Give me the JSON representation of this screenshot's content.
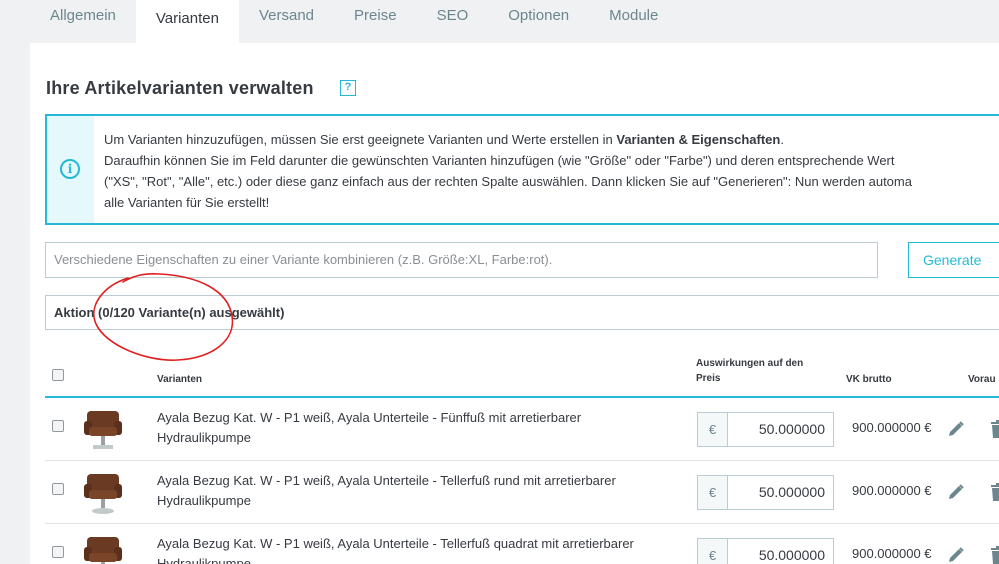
{
  "tabs": [
    {
      "label": "Allgemein",
      "active": false
    },
    {
      "label": "Varianten",
      "active": true
    },
    {
      "label": "Versand",
      "active": false
    },
    {
      "label": "Preise",
      "active": false
    },
    {
      "label": "SEO",
      "active": false
    },
    {
      "label": "Optionen",
      "active": false
    },
    {
      "label": "Module",
      "active": false
    }
  ],
  "section": {
    "title": "Ihre Artikelvarianten verwalten",
    "help_icon": "?"
  },
  "info": {
    "icon": "info-icon",
    "line1_prefix": "Um Varianten hinzuzufügen, müssen Sie erst geeignete Varianten und Werte erstellen in ",
    "line1_bold": "Varianten & Eigenschaften",
    "line1_suffix": ".",
    "line2": "Daraufhin können Sie im Feld darunter die gewünschten Varianten hinzufügen (wie \"Größe\" oder \"Farbe\") und deren entsprechende Wert",
    "line3": "(\"XS\", \"Rot\", \"Alle\", etc.) oder diese ganz einfach aus der rechten Spalte auswählen. Dann klicken Sie auf \"Generieren\": Nun werden automa",
    "line4": "alle Varianten für Sie erstellt!"
  },
  "combine": {
    "placeholder": "Verschiedene Eigenschaften zu einer Variante kombinieren (z.B. Größe:XL, Farbe:rot).",
    "value": ""
  },
  "generate_button": "Generate",
  "action_bar": "Aktion (0/120 Variante(n) ausgewählt)",
  "table": {
    "headers": {
      "variants": "Varianten",
      "impact_line1": "Auswirkungen auf den",
      "impact_line2": "Preis",
      "vk": "VK brutto",
      "default": "Vorau"
    },
    "rows": [
      {
        "name_line1": "Ayala Bezug Kat. W - P1 weiß, Ayala Unterteile - Fünffuß mit arretierbarer",
        "name_line2": "Hydraulikpumpe",
        "currency": "€",
        "impact": "50.000000",
        "vk": "900.000000 €"
      },
      {
        "name_line1": "Ayala Bezug Kat. W - P1 weiß, Ayala Unterteile - Tellerfuß rund mit arretierbarer",
        "name_line2": "Hydraulikpumpe",
        "currency": "€",
        "impact": "50.000000",
        "vk": "900.000000 €"
      },
      {
        "name_line1": "Ayala Bezug Kat. W - P1 weiß, Ayala Unterteile - Tellerfuß quadrat mit arretierbarer",
        "name_line2": "Hydraulikpumpe",
        "currency": "€",
        "impact": "50.000000",
        "vk": "900.000000 €"
      }
    ]
  },
  "colors": {
    "accent": "#25b9d7",
    "annotation": "#e02020"
  }
}
